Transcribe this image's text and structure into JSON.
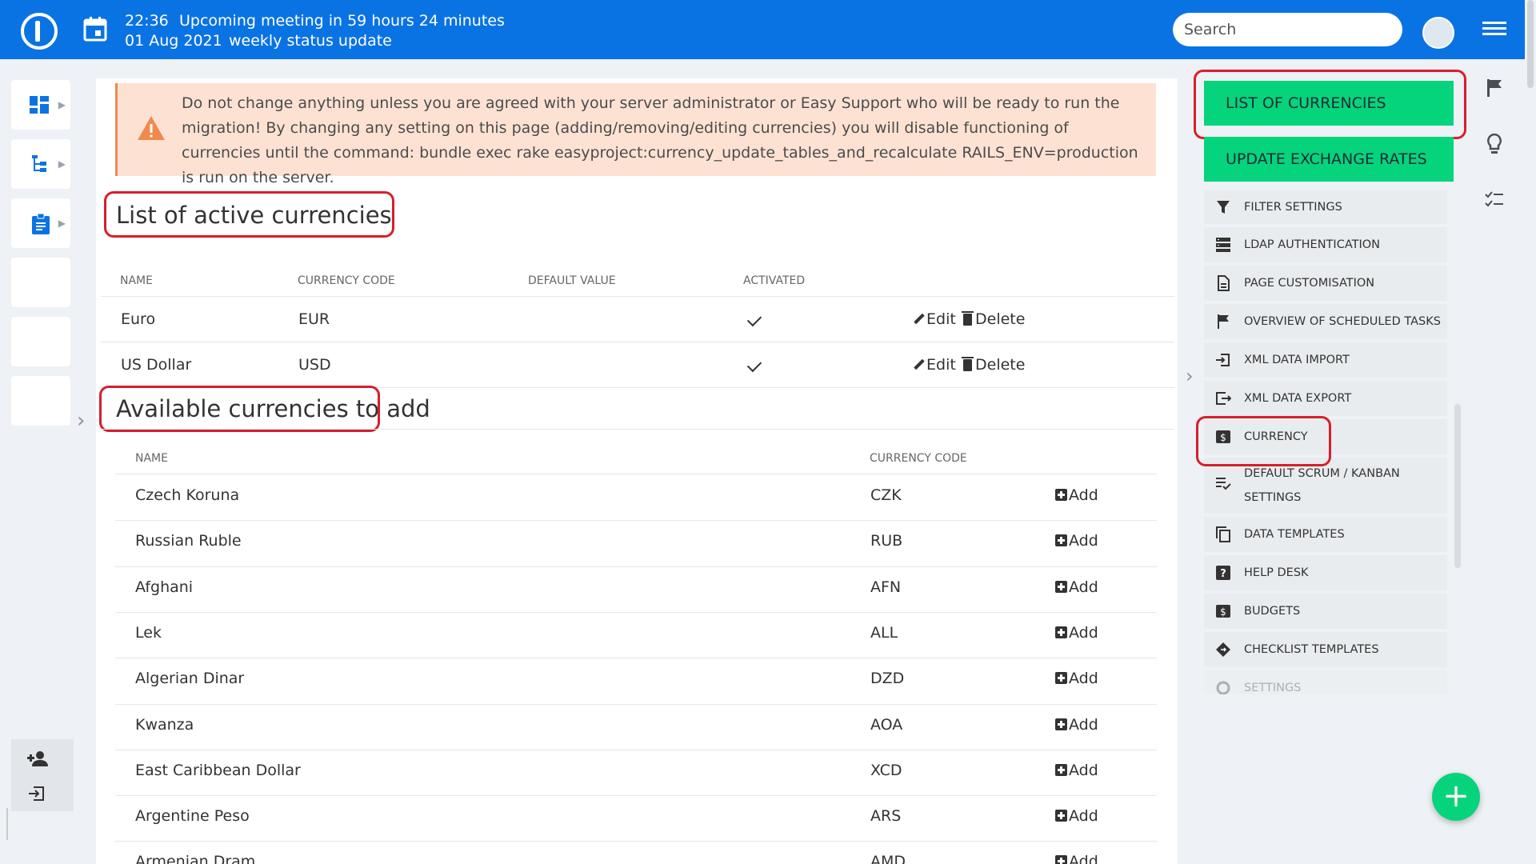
{
  "header": {
    "time": "22:36",
    "meeting": "Upcoming meeting in 59 hours 24 minutes",
    "date": "01 Aug 2021",
    "meeting_title": "weekly status update",
    "search_placeholder": "Search"
  },
  "warning": {
    "text": "Do not change anything unless you are agreed with your server administrator or Easy Support who will be ready to run the migration! By changing any setting on this page (adding/removing/editing currencies) you will disable functioning of currencies until the command: bundle exec rake easyproject:currency_update_tables_and_recalculate RAILS_ENV=production is run on the server."
  },
  "active": {
    "title": "List of active currencies",
    "columns": [
      "NAME",
      "CURRENCY CODE",
      "DEFAULT VALUE",
      "ACTIVATED"
    ],
    "rows": [
      {
        "name": "Euro",
        "code": "EUR",
        "activated": true
      },
      {
        "name": "US Dollar",
        "code": "USD",
        "activated": true
      }
    ],
    "edit_label": "Edit",
    "delete_label": "Delete"
  },
  "available": {
    "title": "Available currencies to add",
    "columns": [
      "NAME",
      "CURRENCY CODE"
    ],
    "add_label": "Add",
    "rows": [
      {
        "name": "Czech Koruna",
        "code": "CZK"
      },
      {
        "name": "Russian Ruble",
        "code": "RUB"
      },
      {
        "name": "Afghani",
        "code": "AFN"
      },
      {
        "name": "Lek",
        "code": "ALL"
      },
      {
        "name": "Algerian Dinar",
        "code": "DZD"
      },
      {
        "name": "Kwanza",
        "code": "AOA"
      },
      {
        "name": "East Caribbean Dollar",
        "code": "XCD"
      },
      {
        "name": "Argentine Peso",
        "code": "ARS"
      },
      {
        "name": "Armenian Dram",
        "code": "AMD"
      }
    ]
  },
  "sidebar": {
    "list_of_currencies": "LIST OF CURRENCIES",
    "update_exchange_rates": "UPDATE EXCHANGE RATES",
    "items": [
      {
        "label": "FILTER SETTINGS",
        "icon": "filter-icon"
      },
      {
        "label": "LDAP AUTHENTICATION",
        "icon": "server-icon"
      },
      {
        "label": "PAGE CUSTOMISATION",
        "icon": "page-icon"
      },
      {
        "label": "OVERVIEW OF SCHEDULED TASKS",
        "icon": "flag-icon"
      },
      {
        "label": "XML DATA IMPORT",
        "icon": "import-icon"
      },
      {
        "label": "XML DATA EXPORT",
        "icon": "export-icon"
      },
      {
        "label": "CURRENCY",
        "icon": "currency-icon"
      },
      {
        "label": "DEFAULT SCRUM / KANBAN SETTINGS",
        "icon": "list-check-icon"
      },
      {
        "label": "DATA TEMPLATES",
        "icon": "copy-icon"
      },
      {
        "label": "HELP DESK",
        "icon": "help-icon"
      },
      {
        "label": "BUDGETS",
        "icon": "currency-icon"
      },
      {
        "label": "CHECKLIST TEMPLATES",
        "icon": "diamond-icon"
      },
      {
        "label": "SETTINGS",
        "icon": "gear-icon"
      }
    ]
  },
  "colors": {
    "header": "#0a73e3",
    "accent_green": "#05d47c",
    "highlight_red": "#d61f2b",
    "warning_bg": "#fde2d3"
  }
}
